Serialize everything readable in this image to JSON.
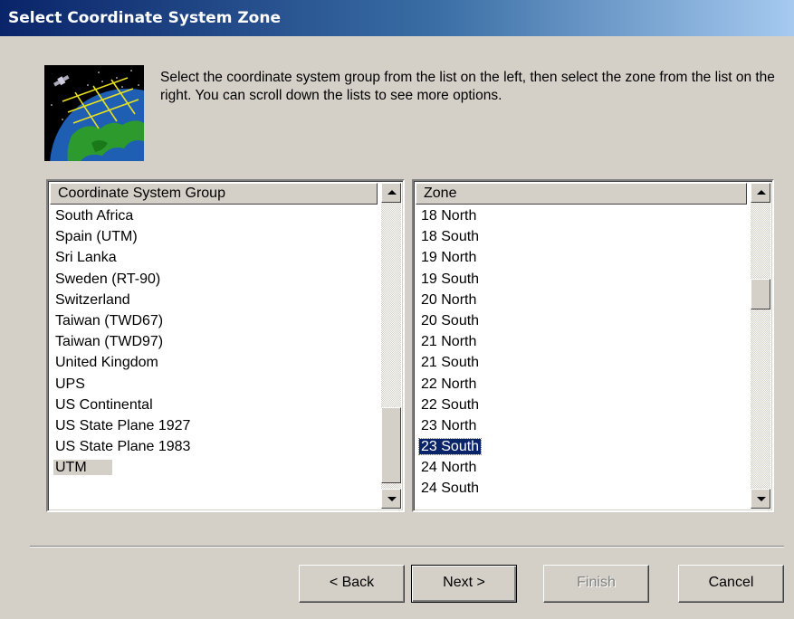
{
  "window": {
    "title": "Select Coordinate System Zone"
  },
  "intro_text": "Select the coordinate system group from the list on the left, then select the zone from the list on the right.  You can scroll down the lists to see more options.",
  "group_list": {
    "header": "Coordinate System Group",
    "items": [
      "South Africa",
      "Spain (UTM)",
      "Sri Lanka",
      "Sweden (RT-90)",
      "Switzerland",
      "Taiwan (TWD67)",
      "Taiwan (TWD97)",
      "United Kingdom",
      "UPS",
      "US Continental",
      "US State Plane 1927",
      "US State Plane 1983",
      "UTM"
    ],
    "selected": "UTM"
  },
  "zone_list": {
    "header": "Zone",
    "items": [
      "18 North",
      "18 South",
      "19 North",
      "19 South",
      "20 North",
      "20 South",
      "21 North",
      "21 South",
      "22 North",
      "22 South",
      "23 North",
      "23 South",
      "24 North",
      "24 South"
    ],
    "selected": "23 South"
  },
  "buttons": {
    "back": "< Back",
    "next": "Next >",
    "finish": "Finish",
    "cancel": "Cancel"
  },
  "icons": {
    "scroll_up": "scroll-up-arrow-icon",
    "scroll_down": "scroll-down-arrow-icon",
    "graphic": "globe-satellite-icon"
  }
}
